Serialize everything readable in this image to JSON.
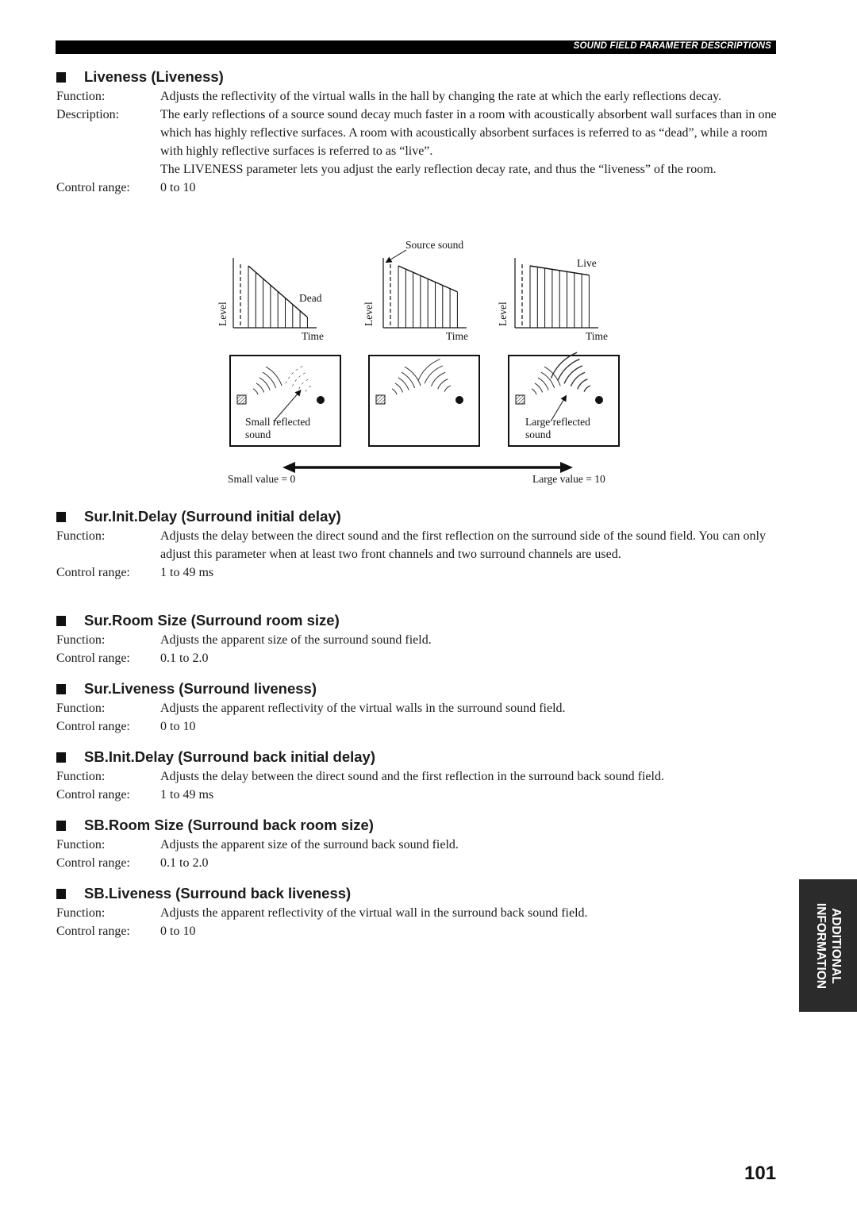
{
  "header": {
    "title": "SOUND FIELD PARAMETER DESCRIPTIONS"
  },
  "labels": {
    "function": "Function:",
    "description": "Description:",
    "control_range": "Control range:"
  },
  "sections": [
    {
      "heading": "Liveness (Liveness)",
      "function": "Adjusts the reflectivity of the virtual walls in the hall by changing the rate at which the early reflections decay.",
      "description": [
        "The early reflections of a source sound decay much faster in a room with acoustically absorbent wall surfaces than in one which has highly reflective surfaces. A room with acoustically absorbent surfaces is referred to as “dead”, while a room with highly reflective surfaces is referred to as “live”.",
        "The LIVENESS parameter lets you adjust the early reflection decay rate, and thus the “liveness” of the room."
      ],
      "control_range": "0 to 10"
    },
    {
      "heading": "Sur.Init.Delay (Surround initial delay)",
      "function": "Adjusts the delay between the direct sound and the first reflection on the surround side of the sound field. You can only adjust this parameter when at least two front channels and two surround channels are used.",
      "control_range": "1 to 49 ms"
    },
    {
      "heading": "Sur.Room Size (Surround room size)",
      "function": "Adjusts the apparent size of the surround sound field.",
      "control_range": "0.1 to 2.0"
    },
    {
      "heading": "Sur.Liveness (Surround liveness)",
      "function": "Adjusts the apparent reflectivity of the virtual walls in the surround sound field.",
      "control_range": "0 to 10"
    },
    {
      "heading": "SB.Init.Delay (Surround back initial delay)",
      "function": "Adjusts the delay between the direct sound and the first reflection in the surround back sound field.",
      "control_range": "1 to 49 ms"
    },
    {
      "heading": "SB.Room Size (Surround back room size)",
      "function": "Adjusts the apparent size of the surround back sound field.",
      "control_range": "0.1 to 2.0"
    },
    {
      "heading": "SB.Liveness (Surround back liveness)",
      "function": "Adjusts the apparent reflectivity of the virtual wall in the surround back sound field.",
      "control_range": "0 to 10"
    }
  ],
  "figure": {
    "source_sound_label": "Source sound",
    "axis_y_label": "Level",
    "axis_x_label": "Time",
    "dead_label": "Dead",
    "live_label": "Live",
    "small_reflected_line1": "Small reflected",
    "small_reflected_line2": "sound",
    "large_reflected_line1": "Large reflected",
    "large_reflected_line2": "sound",
    "scale_min_label": "Small value = 0",
    "scale_max_label": "Large value = 10",
    "decay_graphs": [
      {
        "name": "dead",
        "start_level": 1.0,
        "end_level": 0.17
      },
      {
        "name": "medium",
        "start_level": 1.0,
        "end_level": 0.58
      },
      {
        "name": "live",
        "start_level": 1.0,
        "end_level": 0.85
      }
    ]
  },
  "side_tab": {
    "line1": "ADDITIONAL",
    "line2": "INFORMATION"
  },
  "page_number": "101"
}
